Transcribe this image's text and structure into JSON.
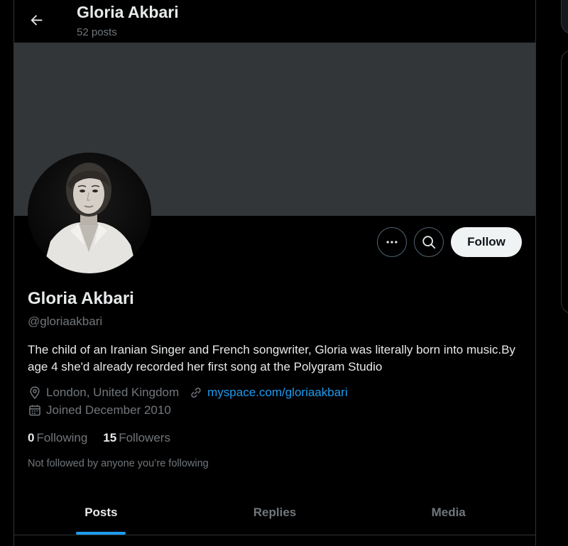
{
  "header": {
    "title": "Gloria Akbari",
    "posts_count": "52 posts"
  },
  "profile": {
    "display_name": "Gloria Akbari",
    "handle": "@gloriaakbari",
    "bio": "The child of an Iranian Singer and French songwriter, Gloria was literally born into music.By age 4 she'd already recorded her first song at the Polygram Studio",
    "location": "London, United Kingdom",
    "website": "myspace.com/gloriaakbari",
    "joined": "Joined December 2010",
    "following_count": "0",
    "following_label": "Following",
    "followers_count": "15",
    "followers_label": "Followers",
    "not_followed_text": "Not followed by anyone you’re following"
  },
  "actions": {
    "more_icon": "more-icon",
    "search_icon": "search-icon",
    "follow_label": "Follow"
  },
  "tabs": [
    {
      "label": "Posts",
      "active": true
    },
    {
      "label": "Replies",
      "active": false
    },
    {
      "label": "Media",
      "active": false
    }
  ],
  "colors": {
    "accent": "#1d9bf0",
    "banner": "#333639",
    "muted_text": "#71767b"
  }
}
